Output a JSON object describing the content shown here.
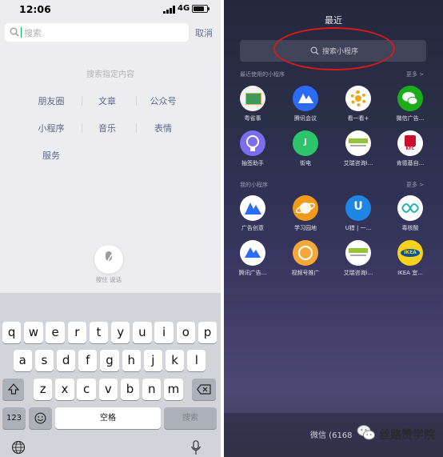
{
  "left_phone": {
    "status_bar": {
      "time": "12:06",
      "network": "4G"
    },
    "search": {
      "placeholder": "搜索",
      "cancel_label": "取消"
    },
    "hint": "搜索指定内容",
    "categories": [
      "朋友圈",
      "文章",
      "公众号",
      "小程序",
      "音乐",
      "表情",
      "服务"
    ],
    "voice_label": "按住 说话",
    "keyboard": {
      "row1": [
        "q",
        "w",
        "e",
        "r",
        "t",
        "y",
        "u",
        "i",
        "o",
        "p"
      ],
      "row2": [
        "a",
        "s",
        "d",
        "f",
        "g",
        "h",
        "j",
        "k",
        "l"
      ],
      "row3": [
        "z",
        "x",
        "c",
        "v",
        "b",
        "n",
        "m"
      ],
      "numbers_key": "123",
      "space_key": "空格",
      "search_key": "搜索",
      "shift_icon": "shift-icon",
      "delete_icon": "delete-icon",
      "emoji_icon": "emoji-icon",
      "globe_icon": "globe-icon",
      "mic_icon": "microphone-icon"
    }
  },
  "right_phone": {
    "title": "最近",
    "search_placeholder": "搜索小程序",
    "recent_section": {
      "label": "最近使用的小程序",
      "more": "更多 >"
    },
    "recent_apps": [
      {
        "label": "粤省事",
        "color": "#f2f2f2"
      },
      {
        "label": "腾讯会议",
        "color": "#2b6bf6"
      },
      {
        "label": "看一看+",
        "color": "#ffffff"
      },
      {
        "label": "微信广告...",
        "color": "#1aad19"
      },
      {
        "label": "抽签助手",
        "color": "#7b6cf0"
      },
      {
        "label": "街电",
        "color": "#2ec46b"
      },
      {
        "label": "艾瑞咨询i...",
        "color": "#ffffff"
      },
      {
        "label": "肯德基自...",
        "color": "#ffffff"
      }
    ],
    "mine_section": {
      "label": "我的小程序",
      "more": "更多 >"
    },
    "mine_apps": [
      {
        "label": "广告创意",
        "color": "#ffffff"
      },
      {
        "label": "学习园地",
        "color": "#f39a1a"
      },
      {
        "label": "U猎 | 一...",
        "color": "#1f86e6"
      },
      {
        "label": "毒核酸",
        "color": "#ffffff"
      },
      {
        "label": "腾讯广告...",
        "color": "#ffffff"
      },
      {
        "label": "视频号推广",
        "color": "#f5a83a"
      },
      {
        "label": "艾瑞咨询i...",
        "color": "#ffffff"
      },
      {
        "label": "IKEA 宜...",
        "color": "#f6d31a"
      }
    ],
    "bottom_text": "微信 (6168",
    "watermark": "丝路赞学院"
  },
  "colors": {
    "annotation_oval": "#d51a1a",
    "wechat_green": "#11b05c",
    "link_blue": "#59709a"
  }
}
